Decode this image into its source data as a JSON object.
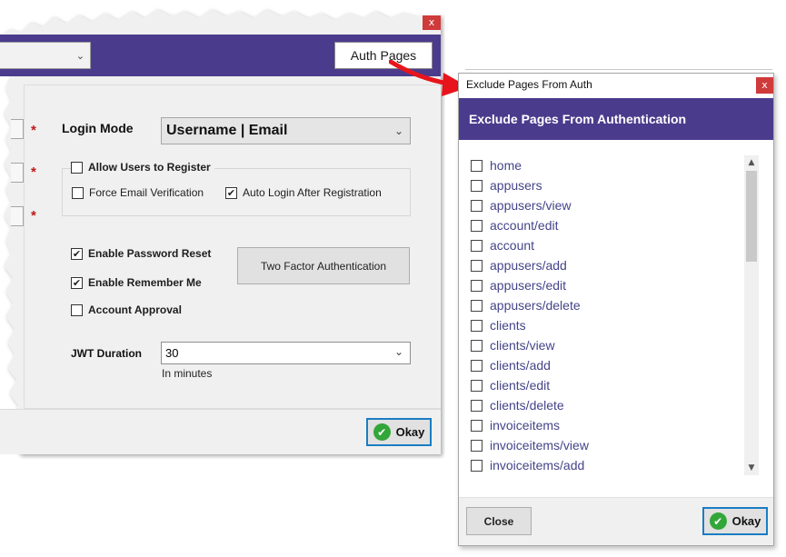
{
  "main_window": {
    "close_glyph": "x",
    "auth_pages_label": "Auth Pages",
    "login_mode_label": "Login Mode",
    "login_mode_value": "Username | Email",
    "allow_register_label": "Allow Users to Register",
    "force_email_label": "Force Email Verification",
    "auto_login_label": "Auto Login After Registration",
    "enable_password_reset_label": "Enable Password Reset",
    "enable_remember_me_label": "Enable Remember Me",
    "account_approval_label": "Account Approval",
    "two_factor_label": "Two Factor Authentication",
    "jwt_label": "JWT Duration",
    "jwt_value": "30",
    "jwt_hint": "In minutes",
    "required_marker": "*",
    "okay_label": "Okay",
    "checkbox_states": {
      "allow_register": false,
      "force_email": false,
      "auto_login": true,
      "enable_password_reset": true,
      "enable_remember_me": true,
      "account_approval": false
    }
  },
  "dialog": {
    "title": "Exclude Pages From Auth",
    "close_glyph": "x",
    "header": "Exclude Pages From Authentication",
    "pages": [
      "home",
      "appusers",
      "appusers/view",
      "account/edit",
      "account",
      "appusers/add",
      "appusers/edit",
      "appusers/delete",
      "clients",
      "clients/view",
      "clients/add",
      "clients/edit",
      "clients/delete",
      "invoiceitems",
      "invoiceitems/view",
      "invoiceitems/add"
    ],
    "close_label": "Close",
    "okay_label": "Okay"
  },
  "colors": {
    "header_purple": "#4b3b8c",
    "close_red": "#cf3a3a",
    "arrow_red": "#e8141c",
    "link_text": "#44448a",
    "ok_border": "#1a7dc4",
    "ok_check": "#33a63a"
  }
}
